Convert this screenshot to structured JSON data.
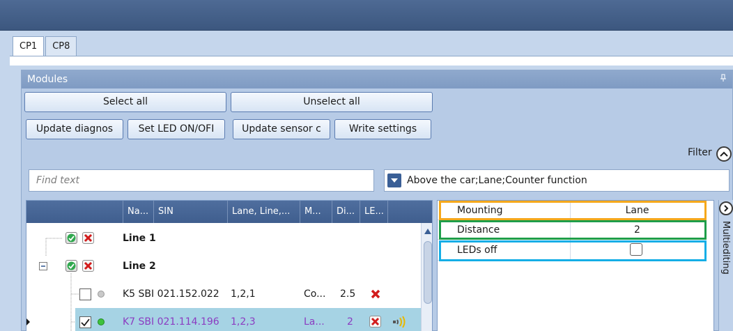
{
  "tabs": [
    {
      "label": "CP1"
    },
    {
      "label": "CP8"
    }
  ],
  "panel": {
    "title": "Modules",
    "pin": "ᵖ"
  },
  "buttons": {
    "select_all": "Select all",
    "unselect_all": "Unselect all",
    "update_diagnos": "Update diagnos",
    "set_led": "Set LED ON/OFI",
    "update_sensor": "Update sensor c",
    "write_settings": "Write settings"
  },
  "filter": {
    "label": "Filter"
  },
  "search": {
    "placeholder": "Find text"
  },
  "combo": {
    "value": "Above the car;Lane;Counter function"
  },
  "grid": {
    "columns": [
      "Na...",
      "SIN",
      "Lane, Line,...",
      "M...",
      "Di...",
      "LE..."
    ],
    "rows": [
      {
        "name": "Line 1"
      },
      {
        "name": "Line 2"
      },
      {
        "name": "K5 SBI 021.152.022",
        "lane": "1,2,1",
        "mounting": "Co...",
        "distance": "2.5"
      },
      {
        "name": "K7 SBI 021.114.196",
        "lane": "1,2,3",
        "mounting": "La...",
        "distance": "2"
      }
    ]
  },
  "properties": [
    {
      "name": "Mounting",
      "value": "Lane"
    },
    {
      "name": "Distance",
      "value": "2"
    },
    {
      "name": "LEDs off",
      "value": ""
    }
  ],
  "multiediting": {
    "label": "Multiediting"
  },
  "colors": {
    "mounting_highlight": "#f5a81c",
    "distance_highlight": "#1e9e4a",
    "leds_highlight": "#15aee6",
    "selected_row": "#a6d3e4",
    "purple_text": "#8b3cc1"
  }
}
